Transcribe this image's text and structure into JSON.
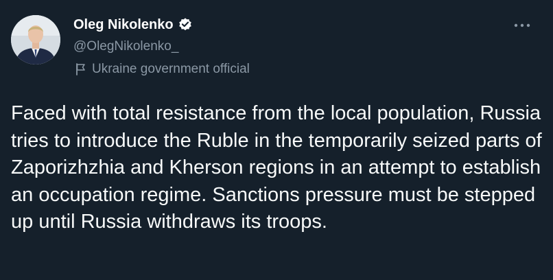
{
  "author": {
    "name": "Oleg Nikolenko",
    "handle": "@OlegNikolenko_",
    "affiliation": "Ukraine government official",
    "verified": true
  },
  "icons": {
    "verified": "verified-badge-icon",
    "affiliation": "flag-icon",
    "more": "more-options-icon"
  },
  "tweet": {
    "text": "Faced with total resistance from the local population, Russia tries to introduce the Ruble in the temporarily seized parts of Zaporizhzhia and Kherson regions in an attempt to establish an occupation regime. Sanctions pressure must be stepped up until Russia withdraws its troops."
  },
  "colors": {
    "background": "#15202b",
    "primary_text": "#f7f9f9",
    "secondary_text": "#8b98a5",
    "link": "#1d9bf0"
  }
}
